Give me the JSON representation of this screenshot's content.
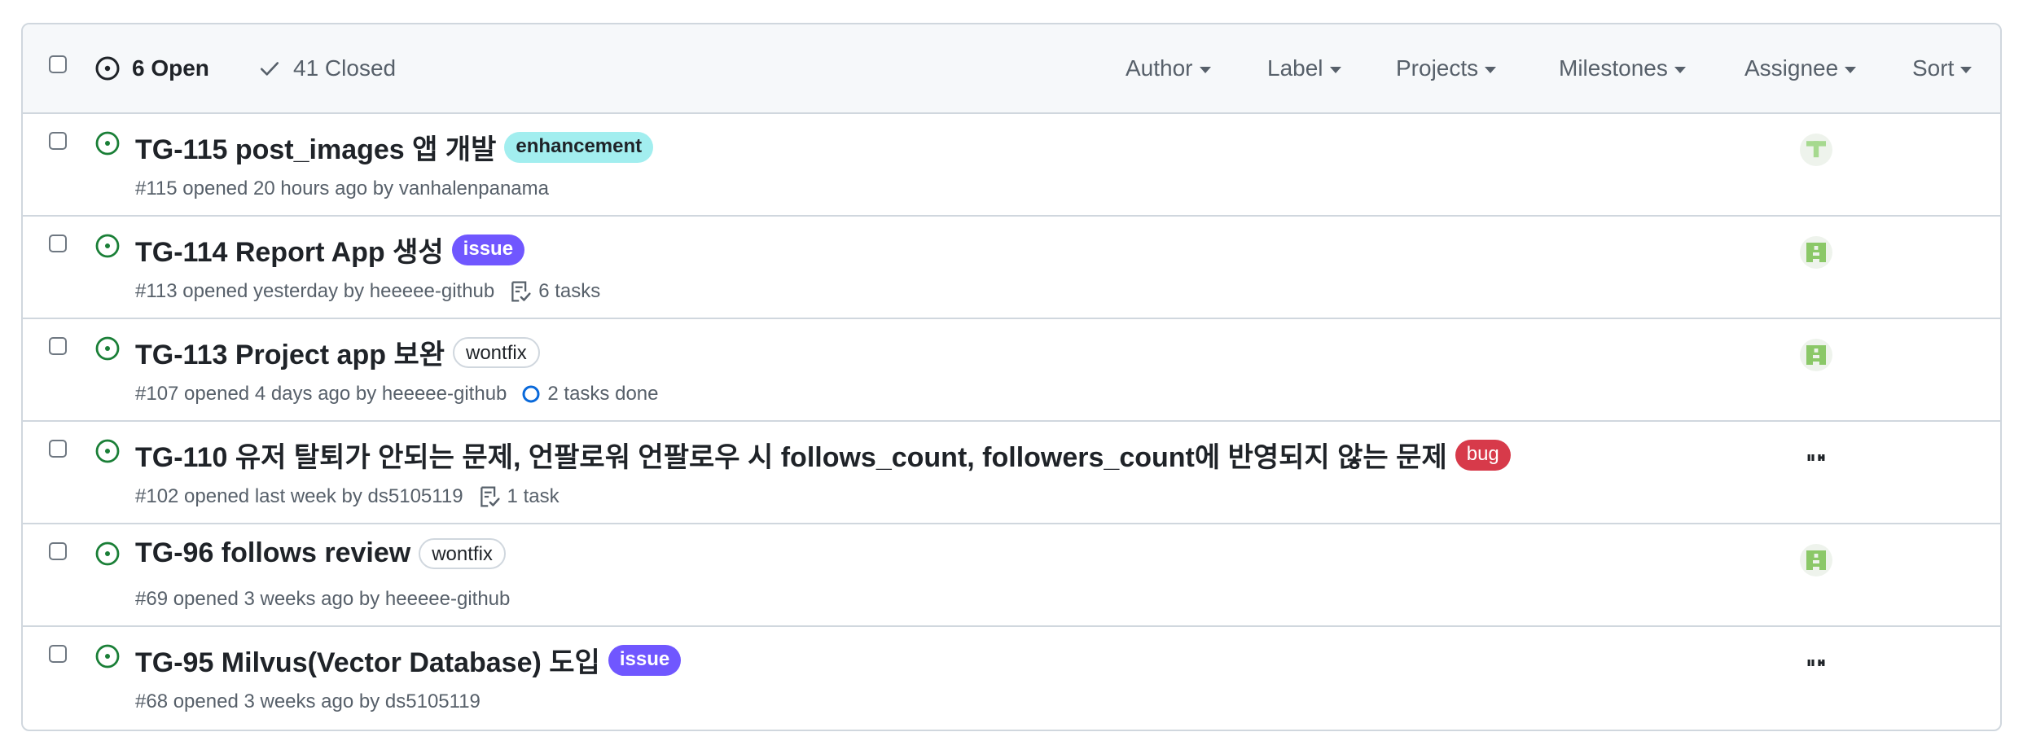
{
  "header": {
    "open_label": "6 Open",
    "closed_label": "41 Closed",
    "filters": {
      "author": "Author",
      "label": "Label",
      "projects": "Projects",
      "milestones": "Milestones",
      "assignee": "Assignee",
      "sort": "Sort"
    }
  },
  "colors": {
    "open_icon": "#1a7f37",
    "label_enhancement": "#a2eeef",
    "label_issue": "#7057ff",
    "label_wontfix": "#ffffff",
    "label_bug": "#d73a4a",
    "task_progress": "#0969da"
  },
  "issues": [
    {
      "title": "TG-115 post_images 앱 개발",
      "label": "enhancement",
      "meta": "#115 opened 20 hours ago by vanhalenpanama",
      "tasks": "",
      "assignee_avatar": "identicon-light-green"
    },
    {
      "title": "TG-114 Report App 생성",
      "label": "issue",
      "meta": "#113 opened yesterday by heeeee-github",
      "tasks": "6 tasks",
      "assignee_avatar": "identicon-green"
    },
    {
      "title": "TG-113 Project app 보완",
      "label": "wontfix",
      "meta": "#107 opened 4 days ago by heeeee-github",
      "tasks": "2 tasks done",
      "assignee_avatar": "identicon-green"
    },
    {
      "title": "TG-110 유저 탈퇴가 안되는 문제, 언팔로워 언팔로우 시 follows_count, followers_count에 반영되지 않는 문제",
      "label": "bug",
      "meta": "#102 opened last week by ds5105119",
      "tasks": "1 task",
      "assignee_avatar": "identicon-black"
    },
    {
      "title": "TG-96 follows review",
      "label": "wontfix",
      "meta": "#69 opened 3 weeks ago by heeeee-github",
      "tasks": "",
      "assignee_avatar": "identicon-green"
    },
    {
      "title": "TG-95 Milvus(Vector Database) 도입",
      "label": "issue",
      "meta": "#68 opened 3 weeks ago by ds5105119",
      "tasks": "",
      "assignee_avatar": "identicon-black"
    }
  ]
}
